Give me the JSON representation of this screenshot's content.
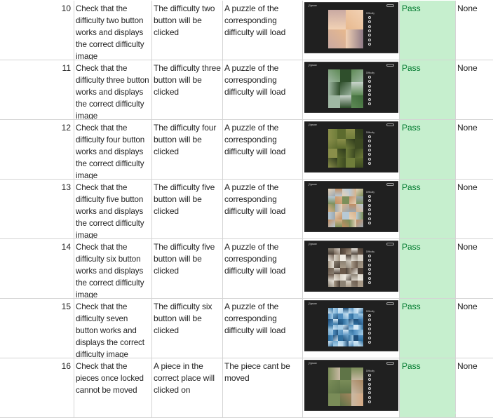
{
  "sheet": {
    "result_color": "#c6efce",
    "result_text_color": "#007a2e",
    "thumbnail_logo": "Jigsaw",
    "thumbnail_side_label": "Difficulty",
    "thumbnail_button_count": 7,
    "rows": [
      {
        "num": "10",
        "test": "Check that the difficulty two button works and displays the correct difficulty image",
        "action": "The difficulty two button will be clicked",
        "expected": "A puzzle of the corresponding difficulty will load",
        "result": "Pass",
        "notes": "None",
        "thumbnail": {
          "grid": 2,
          "palette": [
            "#f2d2b5",
            "#c9a9a2",
            "#8f7a86",
            "#e8b98e"
          ]
        }
      },
      {
        "num": "11",
        "test": "Check that the difficulty three button works and displays the correct difficulty image",
        "action": "The difficulty three button will be clicked",
        "expected": "A puzzle of the corresponding difficulty will load",
        "result": "Pass",
        "notes": "None",
        "thumbnail": {
          "grid": 3,
          "palette": [
            "#3f6b3a",
            "#9fb7a3",
            "#5e8a55",
            "#c9d4cc",
            "#2f4f2c"
          ]
        }
      },
      {
        "num": "12",
        "test": "Check that the difficulty four button works and displays the correct difficulty image",
        "action": "The difficulty four button will be clicked",
        "expected": "A puzzle of the corresponding difficulty will load",
        "result": "Pass",
        "notes": "None",
        "thumbnail": {
          "grid": 4,
          "palette": [
            "#5c6b2e",
            "#3d4a22",
            "#8a8f4a",
            "#6f7d3a",
            "#2e3a1c"
          ]
        }
      },
      {
        "num": "13",
        "test": "Check that the difficulty five button works and displays the correct difficulty image",
        "action": "The difficulty five button will be clicked",
        "expected": "A puzzle of the corresponding difficulty will load",
        "result": "Pass",
        "notes": "None",
        "thumbnail": {
          "grid": 5,
          "palette": [
            "#b7c9d6",
            "#d9b28a",
            "#7c8f5a",
            "#e6d2b8",
            "#9aa7b0",
            "#c28e63"
          ]
        }
      },
      {
        "num": "14",
        "test": "Check that the difficulty six button works and displays the correct difficulty image",
        "action": "The difficulty five button will be clicked",
        "expected": "A puzzle of the corresponding difficulty will load",
        "result": "Pass",
        "notes": "None",
        "thumbnail": {
          "grid": 6,
          "palette": [
            "#d8d2c8",
            "#6b5a4c",
            "#a89a88",
            "#f0ece4",
            "#4a3f36",
            "#8c8274"
          ]
        }
      },
      {
        "num": "15",
        "test": "Check that the difficulty seven button works and displays the correct difficulty image",
        "action": "The difficulty six button will be clicked",
        "expected": "A puzzle of the corresponding difficulty will load",
        "result": "Pass",
        "notes": "None",
        "thumbnail": {
          "grid": 7,
          "palette": [
            "#2f6f9f",
            "#6fa7cf",
            "#a9cfe8",
            "#1f4f7a",
            "#4d8bbd",
            "#d7eaf6"
          ]
        }
      },
      {
        "num": "16",
        "test": "Check that the pieces once locked cannot be moved",
        "action": "A piece in the correct place will clicked on",
        "expected": "The piece cant be moved",
        "result": "Pass",
        "notes": "None",
        "thumbnail": {
          "grid": 3,
          "palette": [
            "#d4a983",
            "#7a8c58",
            "#c9b9a4",
            "#a6855f",
            "#5f7447"
          ]
        }
      }
    ]
  }
}
